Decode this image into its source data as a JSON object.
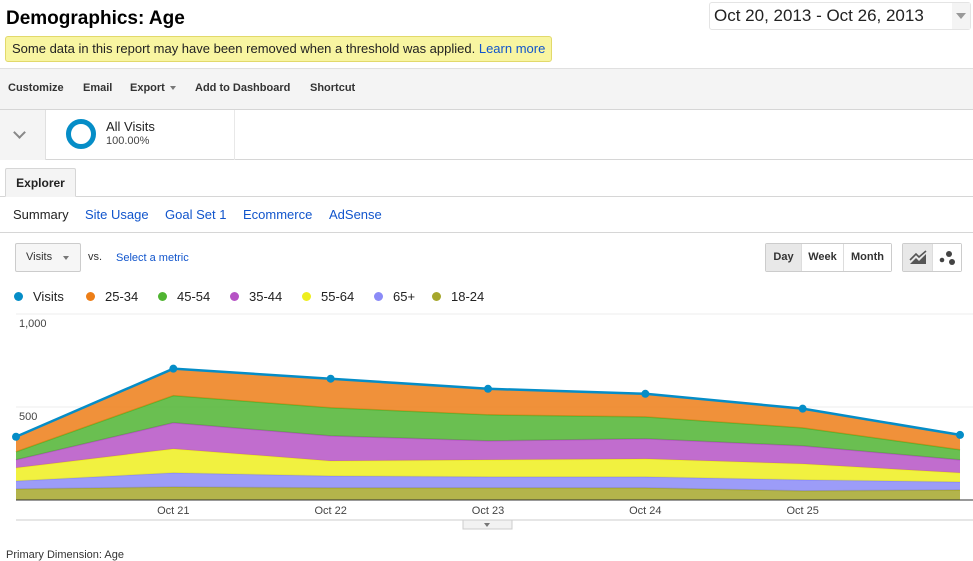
{
  "header": {
    "title": "Demographics: Age",
    "date_range": "Oct 20, 2013 - Oct 26, 2013",
    "notice_text": "Some data in this report may have been removed when a threshold was applied.",
    "notice_link": "Learn more"
  },
  "toolbar": {
    "customize": "Customize",
    "email": "Email",
    "export": "Export",
    "add_to_dashboard": "Add to Dashboard",
    "shortcut": "Shortcut"
  },
  "segment": {
    "name": "All Visits",
    "percent": "100.00%",
    "color": "#058dc7"
  },
  "tabs": {
    "explorer": "Explorer"
  },
  "subtabs": [
    "Summary",
    "Site Usage",
    "Goal Set 1",
    "Ecommerce",
    "AdSense"
  ],
  "controls": {
    "metric": "Visits",
    "vs": "vs.",
    "select_metric": "Select a metric",
    "granularity": [
      "Day",
      "Week",
      "Month"
    ],
    "granularity_selected": "Day",
    "chart_types": [
      "line-chart-icon",
      "motion-chart-icon"
    ]
  },
  "chart_data": {
    "type": "area",
    "stacked": true,
    "title": "",
    "xlabel": "",
    "ylabel": "",
    "x": [
      "Oct 20",
      "Oct 21",
      "Oct 22",
      "Oct 23",
      "Oct 24",
      "Oct 25",
      "Oct 26"
    ],
    "x_tick_labels": [
      "Oct 21",
      "Oct 22",
      "Oct 23",
      "Oct 24",
      "Oct 25"
    ],
    "y_tick_labels": [
      "500",
      "1,000"
    ],
    "ylim": [
      0,
      1000
    ],
    "grid": true,
    "legend_position": "top-left",
    "total_series": {
      "name": "Visits",
      "color": "#058dc7",
      "values": [
        340,
        706,
        652,
        598,
        571,
        491,
        350
      ]
    },
    "series": [
      {
        "name": "18-24",
        "color": "#a6a72c",
        "values": [
          59,
          70,
          65,
          65,
          65,
          49,
          54
        ]
      },
      {
        "name": "65+",
        "color": "#8b8bf7",
        "values": [
          43,
          76,
          64,
          59,
          59,
          59,
          43
        ]
      },
      {
        "name": "55-64",
        "color": "#eeee1e",
        "values": [
          71,
          129,
          81,
          92,
          97,
          86,
          49
        ]
      },
      {
        "name": "35-44",
        "color": "#b653c5",
        "values": [
          43,
          140,
          135,
          102,
          108,
          97,
          70
        ]
      },
      {
        "name": "45-54",
        "color": "#50b432",
        "values": [
          43,
          146,
          151,
          140,
          118,
          97,
          54
        ]
      },
      {
        "name": "25-34",
        "color": "#ed7e17",
        "values": [
          81,
          145,
          156,
          140,
          124,
          103,
          80
        ]
      }
    ],
    "legend_order": [
      "Visits",
      "25-34",
      "45-54",
      "35-44",
      "55-64",
      "65+",
      "18-24"
    ]
  },
  "footer": {
    "primary_dimension_label": "Primary Dimension:",
    "primary_dimension_value": "Age"
  }
}
